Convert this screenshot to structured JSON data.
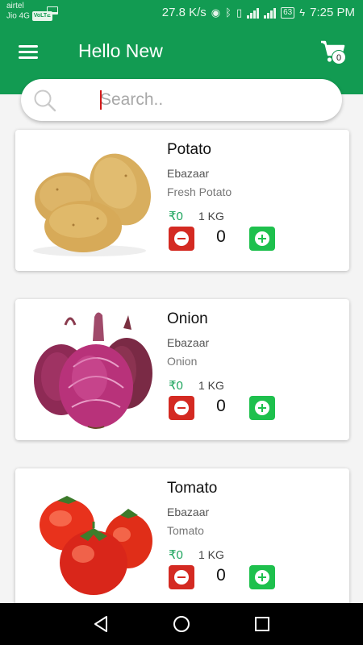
{
  "status_bar": {
    "carrier1": "airtel",
    "carrier2": "Jio 4G",
    "volte": "VoLTE",
    "speed": "27.8 K/s",
    "battery": "63",
    "time": "7:25 PM"
  },
  "header": {
    "title": "Hello New",
    "cart_count": "0"
  },
  "search": {
    "placeholder": "Search.."
  },
  "currency": "₹",
  "products": [
    {
      "name": "Potato",
      "seller": "Ebazaar",
      "description": "Fresh Potato",
      "price": "₹0",
      "unit": "1 KG",
      "quantity": "0"
    },
    {
      "name": "Onion",
      "seller": "Ebazaar",
      "description": "Onion",
      "price": "₹0",
      "unit": "1 KG",
      "quantity": "0"
    },
    {
      "name": "Tomato",
      "seller": "Ebazaar",
      "description": "Tomato",
      "price": "₹0",
      "unit": "1 KG",
      "quantity": "0"
    }
  ],
  "colors": {
    "brand_green": "#129b52",
    "minus_red": "#d42a22",
    "plus_green": "#1ec04d",
    "price_green": "#1aa35b"
  },
  "icons": [
    "menu-icon",
    "cart-icon",
    "search-icon",
    "minus-icon",
    "plus-icon",
    "back-icon",
    "home-icon",
    "recents-icon"
  ]
}
